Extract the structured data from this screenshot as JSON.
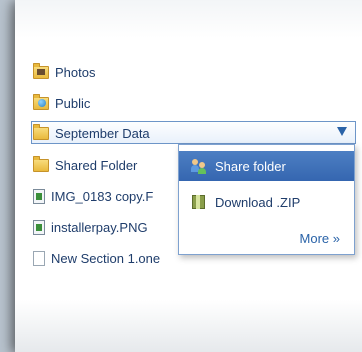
{
  "file_list": {
    "items": [
      {
        "label": "Photos",
        "icon": "photos-folder-icon"
      },
      {
        "label": "Public",
        "icon": "public-folder-icon"
      },
      {
        "label": "September Data",
        "icon": "folder-icon",
        "selected": true
      },
      {
        "label": "Shared Folder",
        "icon": "folder-icon"
      },
      {
        "label": "IMG_0183 copy.F",
        "icon": "image-file-icon"
      },
      {
        "label": "installerpay.PNG",
        "icon": "image-file-icon"
      },
      {
        "label": "New Section 1.one",
        "icon": "document-file-icon"
      }
    ]
  },
  "context_menu": {
    "share_label": "Share folder",
    "download_label": "Download .ZIP",
    "more_label": "More »"
  },
  "colors": {
    "accent": "#3566b0",
    "text": "#1f3d6b",
    "selection_border": "#6d95c8"
  }
}
